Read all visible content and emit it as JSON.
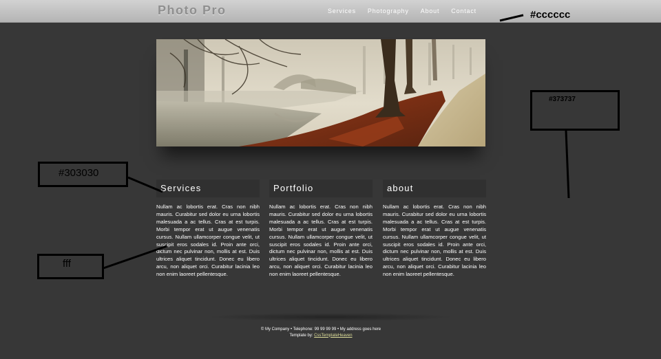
{
  "header": {
    "logo": "Photo Pro",
    "nav": [
      "Services",
      "Photography",
      "About",
      "Contact"
    ]
  },
  "columns": [
    {
      "title": "Services",
      "body": "Nullam ac lobortis erat. Cras non nibh mauris. Curabitur sed dolor eu urna lobortis malesuada a ac tellus. Cras at est turpis. Morbi tempor erat ut augue venenatis cursus. Nullam ullamcorper congue velit, ut suscipit eros sodales id. Proin ante orci, dictum nec pulvinar non, mollis at est. Duis ultrices aliquet tincidunt. Donec eu libero arcu, non aliquet orci. Curabitur lacinia leo non enim laoreet pellentesque."
    },
    {
      "title": "Portfolio",
      "body": "Nullam ac lobortis erat. Cras non nibh mauris. Curabitur sed dolor eu urna lobortis malesuada a ac tellus. Cras at est turpis. Morbi tempor erat ut augue venenatis cursus. Nullam ullamcorper congue velit, ut suscipit eros sodales id. Proin ante orci, dictum nec pulvinar non, mollis at est. Duis ultrices aliquet tincidunt. Donec eu libero arcu, non aliquet orci. Curabitur lacinia leo non enim laoreet pellentesque."
    },
    {
      "title": "about",
      "body": "Nullam ac lobortis erat. Cras non nibh mauris. Curabitur sed dolor eu urna lobortis malesuada a ac tellus. Cras at est turpis. Morbi tempor erat ut augue venenatis cursus. Nullam ullamcorper congue velit, ut suscipit eros sodales id. Proin ante orci, dictum nec pulvinar non, mollis at est. Duis ultrices aliquet tincidunt. Donec eu libero arcu, non aliquet orci. Curabitur lacinia leo non enim laoreet pellentesque."
    }
  ],
  "footer": {
    "line1": "© My Company • Telephone: 99 99 99 99 • My address goes here",
    "credit_prefix": "Template by:",
    "credit_link": "CssTemplateHeaven"
  },
  "annotations": {
    "header_color": "#cccccc",
    "background_color": "#373737",
    "column_header_color": "#303030",
    "text_color": "fff"
  },
  "colors": {
    "background": "#373737",
    "header_bar": "#cccccc",
    "column_header": "#303030",
    "text": "#ffffff"
  }
}
